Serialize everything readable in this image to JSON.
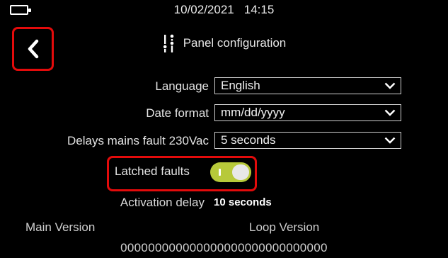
{
  "status": {
    "date": "10/02/2021",
    "time": "14:15"
  },
  "header": {
    "title": "Panel configuration",
    "icon": "settings-sliders-icon"
  },
  "form": {
    "language": {
      "label": "Language",
      "value": "English"
    },
    "date_format": {
      "label": "Date format",
      "value": "mm/dd/yyyy"
    },
    "delays": {
      "label": "Delays mains fault 230Vac",
      "value": "5 seconds"
    },
    "latched_faults": {
      "label": "Latched faults",
      "enabled": true
    },
    "activation_delay": {
      "label": "Activation delay",
      "value": "10 seconds"
    }
  },
  "versions": {
    "main_label": "Main Version",
    "loop_label": "Loop Version",
    "serial": "000000000000000000000000000000"
  },
  "colors": {
    "highlight": "#e30b0b",
    "toggle_on": "#b7c93a",
    "background": "#000000"
  }
}
